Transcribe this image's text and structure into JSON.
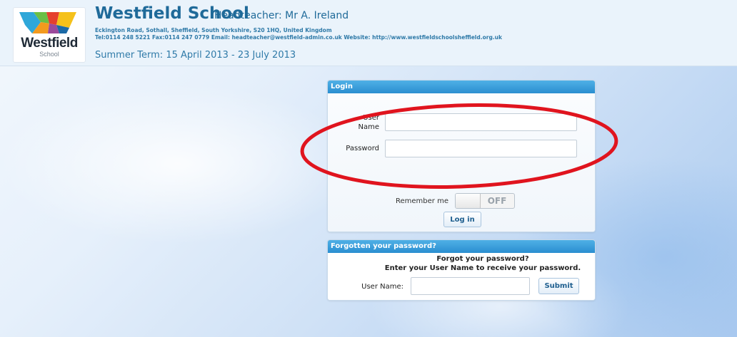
{
  "header": {
    "logo_text": "Westfield",
    "logo_sub": "School",
    "school_name": "Westfield School",
    "headteacher": "Headteacher: Mr A. Ireland",
    "address": "Eckington Road, Sothall, Sheffield, South Yorkshire, S20 1HQ, United Kingdom",
    "contact": "Tel:0114 248 5221   Fax:0114 247 0779   Email: headteacher@westfield-admin.co.uk   Website: http://www.westfieldschoolsheffield.org.uk",
    "term": "Summer Term: 15 April 2013 - 23 July 2013"
  },
  "login": {
    "title": "Login",
    "username_label_1": "User",
    "username_label_2": "Name",
    "username_value": "",
    "password_label": "Password",
    "password_value": "",
    "remember_label": "Remember me",
    "remember_state": "OFF",
    "login_button": "Log in"
  },
  "forgot": {
    "title": "Forgotten your password?",
    "line1": "Forgot your password?",
    "line2": "Enter your User Name to receive your password.",
    "username_label": "User Name:",
    "username_value": "",
    "submit_button": "Submit"
  },
  "colors": {
    "accent": "#2a8ed0",
    "brand_text": "#1f6a99",
    "annotation": "#e0141e"
  }
}
